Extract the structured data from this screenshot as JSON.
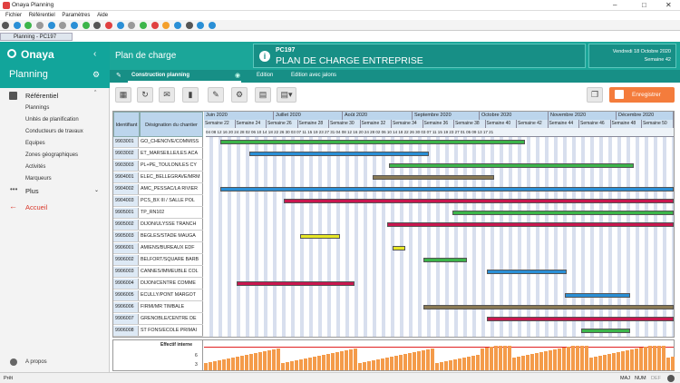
{
  "window": {
    "title": "Onaya Planning",
    "doc_tab": "Planning - PC197"
  },
  "menu": [
    "Fichier",
    "Référentiel",
    "Paramètres",
    "Aide"
  ],
  "sidebar": {
    "brand": "Onaya",
    "section": "Planning",
    "referentiel": "Référentiel",
    "items": [
      "Plannings",
      "Unités de planification",
      "Conducteurs de travaux",
      "Equipes",
      "Zones géographiques",
      "Activités",
      "Marqueurs"
    ],
    "plus": "Plus",
    "accueil": "Accueil",
    "apropos": "A propos"
  },
  "header": {
    "title": "Plan de charge",
    "code": "PC197",
    "name": "PLAN DE CHARGE ENTREPRISE",
    "date": "Vendredi 18 Octobre 2020",
    "week_label": "Semaine",
    "week": "42"
  },
  "tabs": [
    "Construction planning",
    "Edition",
    "Edition avec jalons"
  ],
  "save_label": "Enregistrer",
  "grid": {
    "col_id": "Identifiant",
    "col_desc": "Désignation du chantier",
    "months": [
      "Juin 2020",
      "Juillet 2020",
      "Août 2020",
      "Septembre 2020",
      "Octobre 2020",
      "Novembre 2020",
      "Décembre 2020"
    ],
    "weeks": [
      "Semaine 22",
      "Semaine 24",
      "Semaine 26",
      "Semaine 28",
      "Semaine 30",
      "Semaine 32",
      "Semaine 34",
      "Semaine 36",
      "Semaine 38",
      "Semaine 40",
      "Semaine 42",
      "Semaine 44",
      "Semaine 46",
      "Semaine 48",
      "Semaine 50"
    ],
    "days": "04 08 12 16 20 24 28 02 06 10 14 18 22 26 30 03 07 11 15 19 23 27 31 04 08 12 16 20 24 28 02 06 10 14 18 22 26 30 03 07 11 15 19 23 27 01 05 09 13 17 21",
    "rows": [
      {
        "id": "9903001",
        "desc": "GO_CHENOVE/COMMISS"
      },
      {
        "id": "9903002",
        "desc": "ET_MARSEILLE/LES ACA"
      },
      {
        "id": "9903003",
        "desc": "PL+PE_TOULON/LES CY"
      },
      {
        "id": "9904001",
        "desc": "ELEC_BELLEGRAVE/MRM"
      },
      {
        "id": "9904002",
        "desc": "AMC_PESSAC/LA RIVIER"
      },
      {
        "id": "9904003",
        "desc": "PCS_BX III / SALLE POL"
      },
      {
        "id": "9905001",
        "desc": "TP_RN102"
      },
      {
        "id": "9905002",
        "desc": "DIJON/ULYSSE TRANCH"
      },
      {
        "id": "9905003",
        "desc": "BEGLES/STADE MAUGA"
      },
      {
        "id": "9906001",
        "desc": "AMIENS/BUREAUX EDF"
      },
      {
        "id": "9906002",
        "desc": "BELFORT/SQUARE BARB"
      },
      {
        "id": "9906003",
        "desc": "CANNES/IMMEUBLE COL"
      },
      {
        "id": "9906004",
        "desc": "DIJON/CENTRE COMME"
      },
      {
        "id": "9906005",
        "desc": "ECULLY/PONT MARGOT"
      },
      {
        "id": "9906006",
        "desc": "FIRMI/MR TIMBALE"
      },
      {
        "id": "9906007",
        "desc": "GRENOBLE/CENTRE DE"
      },
      {
        "id": "9906008",
        "desc": "ST FONS/ECOLE PRIMAI"
      }
    ]
  },
  "effectif": {
    "label": "Effectif interne",
    "v1": "6",
    "v2": "3"
  },
  "status": {
    "left": "Prêt",
    "maj": "MAJ",
    "num": "NUM",
    "def": "DEF"
  },
  "colors": {
    "teal": "#1ba699",
    "orange": "#f47c3c",
    "blue": "#2a8fd6",
    "green": "#3cb54a",
    "red": "#c8174f",
    "brown": "#8a7a55",
    "yellow": "#e6e626"
  }
}
